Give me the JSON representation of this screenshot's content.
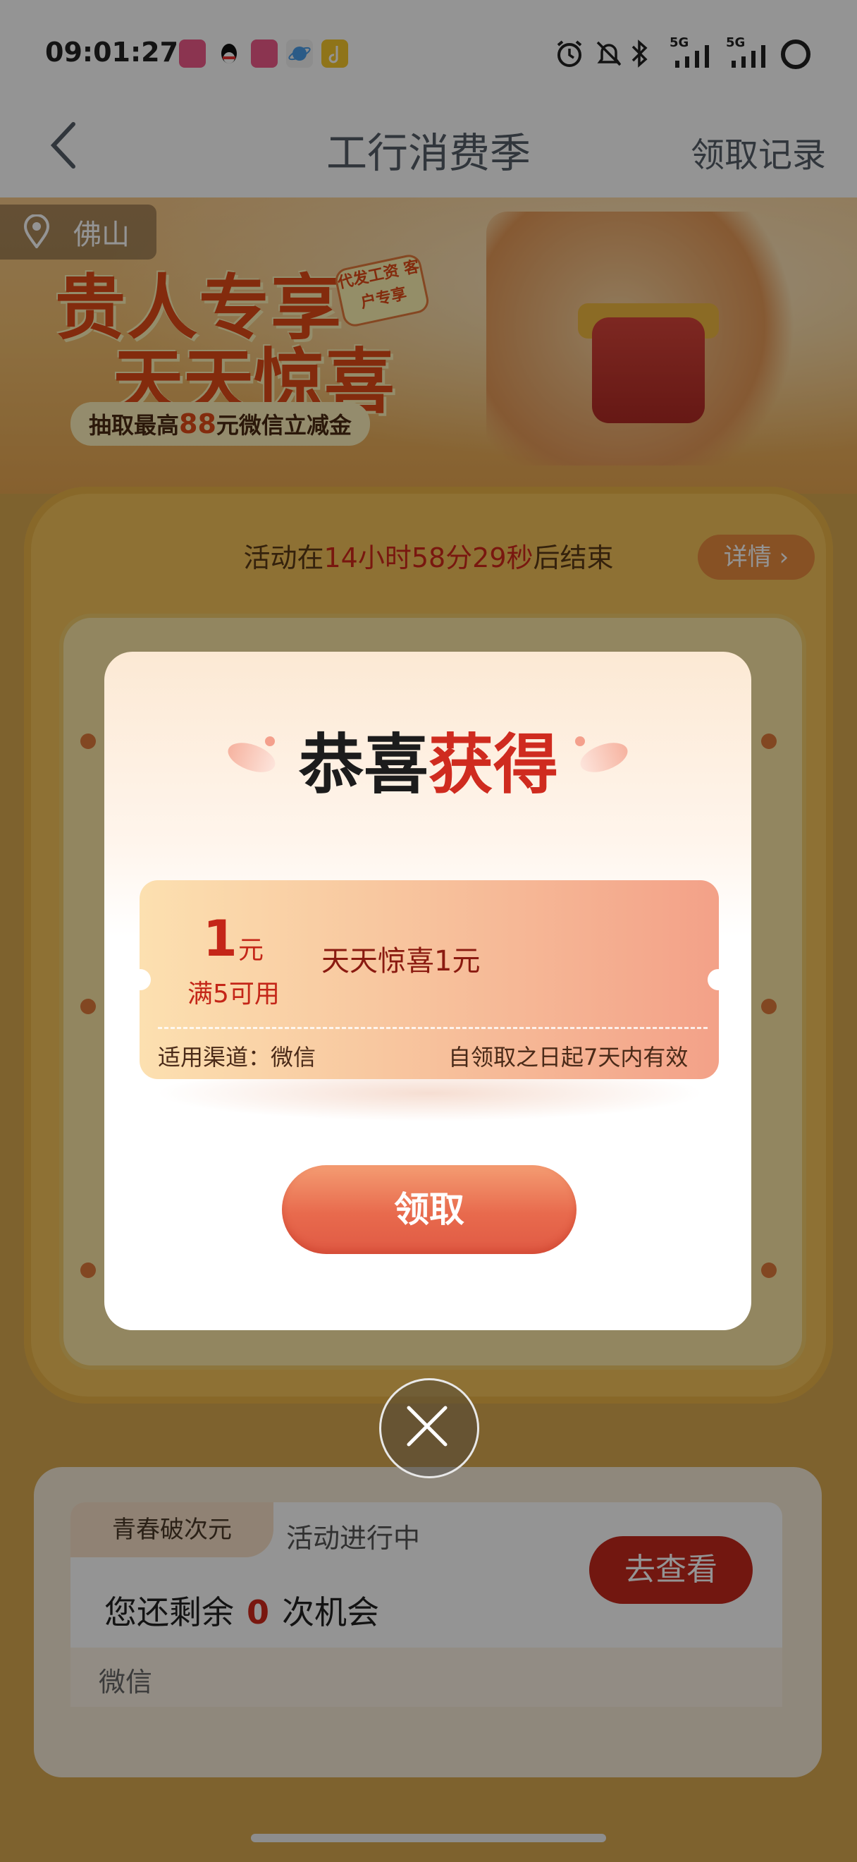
{
  "status_bar": {
    "time": "09:01:27",
    "app_icons": [
      "bilibili-icon",
      "qq-icon",
      "bilibili-icon",
      "browser-icon",
      "music-icon"
    ],
    "system_icons": [
      "alarm-icon",
      "mute-icon",
      "bluetooth-icon",
      "signal-5g-icon",
      "signal-5g-icon",
      "battery-icon"
    ],
    "network_label_1": "5G",
    "network_label_2": "5G"
  },
  "nav": {
    "title": "工行消费季",
    "right_link": "领取记录"
  },
  "banner": {
    "location": "佛山",
    "title_line1": "贵人专享",
    "title_line2": "天天惊喜",
    "tag": "代发工资 客户专享",
    "subtitle_prefix": "抽取最高",
    "subtitle_amount": "88",
    "subtitle_suffix": "元微信立减金"
  },
  "activity": {
    "timer_prefix": "活动在",
    "timer_value": "14小时58分29秒",
    "timer_suffix": "后结束",
    "detail_button": "详情 ›"
  },
  "lower_card": {
    "tag": "青春破次元",
    "status": "活动进行中",
    "remain_prefix": "您还剩余",
    "remain_count": "0",
    "remain_suffix": "次机会",
    "view_button": "去查看",
    "channel": "微信"
  },
  "modal": {
    "title_black": "恭喜",
    "title_red": "获得",
    "coupon": {
      "amount": "1",
      "unit": "元",
      "condition": "满5可用",
      "name": "天天惊喜1元",
      "channel": "适用渠道：微信",
      "validity": "自领取之日起7天内有效"
    },
    "claim_button": "领取",
    "close_icon": "close-icon"
  },
  "colors": {
    "accent_red": "#cf2b1f",
    "claim_button": "#e86a4d",
    "panel_gold": "#f4c35a"
  }
}
